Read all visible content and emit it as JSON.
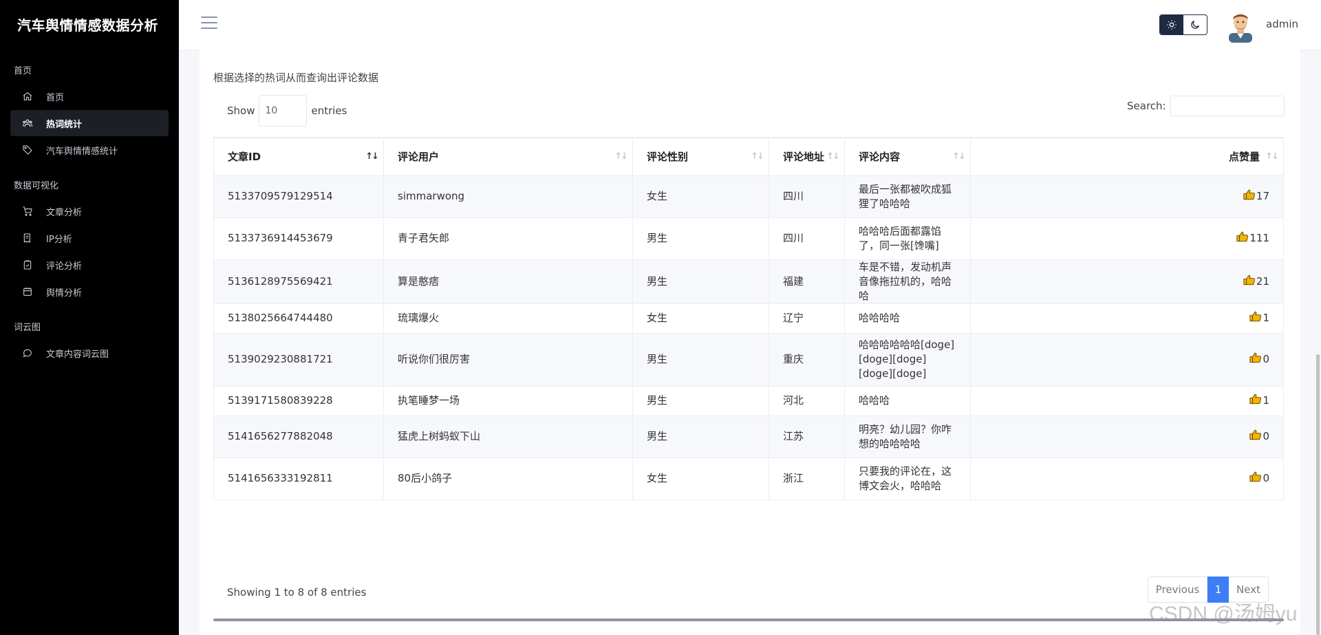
{
  "brand": {
    "title": "汽车舆情情感数据分析"
  },
  "sidebar": {
    "sections": [
      {
        "title": "首页",
        "items": [
          {
            "label": "首页",
            "icon": "home-icon"
          },
          {
            "label": "热词统计",
            "icon": "users-icon",
            "active": true
          },
          {
            "label": "汽车舆情情感统计",
            "icon": "tag-icon"
          }
        ]
      },
      {
        "title": "数据可视化",
        "items": [
          {
            "label": "文章分析",
            "icon": "cart-icon"
          },
          {
            "label": "IP分析",
            "icon": "receipt-icon"
          },
          {
            "label": "评论分析",
            "icon": "clipboard-check-icon"
          },
          {
            "label": "舆情分析",
            "icon": "calendar-icon"
          }
        ]
      },
      {
        "title": "词云图",
        "items": [
          {
            "label": "文章内容词云图",
            "icon": "chat-icon"
          }
        ]
      }
    ]
  },
  "header": {
    "username": "admin",
    "theme": "light"
  },
  "content": {
    "description": "根据选择的热词从而查询出评论数据",
    "show_label": "Show",
    "entries_value": "10",
    "entries_label": "entries",
    "search_label": "Search:",
    "search_value": "",
    "info": "Showing 1 to 8 of 8 entries",
    "pager": {
      "previous": "Previous",
      "current": "1",
      "next": "Next"
    }
  },
  "table": {
    "columns": [
      "文章ID",
      "评论用户",
      "评论性别",
      "评论地址",
      "评论内容",
      "点赞量"
    ],
    "rows": [
      [
        "5133709579129514",
        "simmarwong",
        "女生",
        "四川",
        "最后一张都被吹成狐狸了哈哈哈",
        "17"
      ],
      [
        "5133736914453679",
        "青子君矢郎",
        "男生",
        "四川",
        "哈哈哈后面都露馅了，同一张[馋嘴]",
        "111"
      ],
      [
        "5136128975569421",
        "算是憨痞",
        "男生",
        "福建",
        "车是不错，发动机声音像拖拉机的，哈哈哈",
        "21"
      ],
      [
        "5138025664744480",
        "琉璃爆火",
        "女生",
        "辽宁",
        "哈哈哈哈",
        "1"
      ],
      [
        "5139029230881721",
        "听说你们很厉害",
        "男生",
        "重庆",
        "哈哈哈哈哈哈[doge][doge][doge][doge][doge]",
        "0"
      ],
      [
        "5139171580839228",
        "执笔睡梦一场",
        "男生",
        "河北",
        "哈哈哈",
        "1"
      ],
      [
        "5141656277882048",
        "猛虎上树蚂蚁下山",
        "男生",
        "江苏",
        "明亮？幼儿园？你咋想的哈哈哈哈",
        "0"
      ],
      [
        "5141656333192811",
        "80后小鸽子",
        "女生",
        "浙江",
        "只要我的评论在，这博文会火，哈哈哈",
        "0"
      ]
    ]
  },
  "watermark": "CSDN @汤姆yu",
  "colors": {
    "accent": "#3d7ef6",
    "sidebar_bg": "#000000",
    "thumb": "#f5b400"
  }
}
